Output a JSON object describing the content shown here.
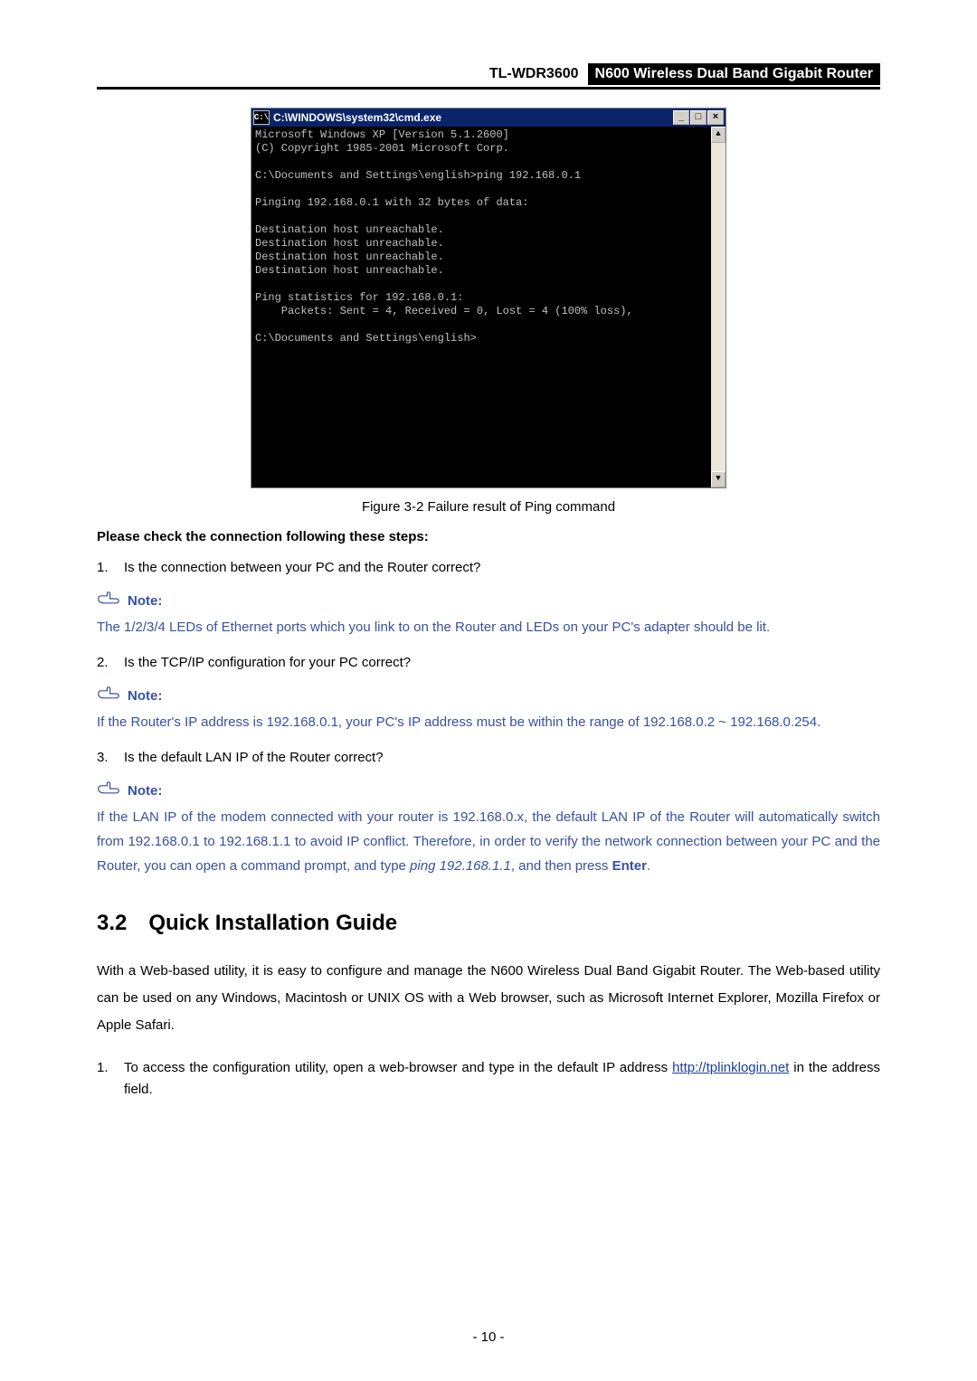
{
  "header": {
    "model": "TL-WDR3600",
    "desc": "N600 Wireless Dual Band Gigabit Router"
  },
  "cmd": {
    "icon_text": "C:\\",
    "title": "C:\\WINDOWS\\system32\\cmd.exe",
    "btn_min": "_",
    "btn_max": "□",
    "btn_close": "×",
    "scroll_up": "▲",
    "scroll_down": "▼",
    "body": "Microsoft Windows XP [Version 5.1.2600]\n(C) Copyright 1985-2001 Microsoft Corp.\n\nC:\\Documents and Settings\\english>ping 192.168.0.1\n\nPinging 192.168.0.1 with 32 bytes of data:\n\nDestination host unreachable.\nDestination host unreachable.\nDestination host unreachable.\nDestination host unreachable.\n\nPing statistics for 192.168.0.1:\n    Packets: Sent = 4, Received = 0, Lost = 4 (100% loss),\n\nC:\\Documents and Settings\\english>"
  },
  "figure_caption": "Figure 3-2 Failure result of Ping command",
  "check_heading": "Please check the connection following these steps:",
  "steps": {
    "s1_num": "1.",
    "s1_text": "Is the connection between your PC and the Router correct?",
    "s2_num": "2.",
    "s2_text": "Is the TCP/IP configuration for your PC correct?",
    "s3_num": "3.",
    "s3_text": "Is the default LAN IP of the Router correct?"
  },
  "notes": {
    "label": "Note:",
    "n1": "The 1/2/3/4 LEDs of Ethernet ports which you link to on the Router and LEDs on your PC's adapter should be lit.",
    "n2": "If the Router's IP address is 192.168.0.1, your PC's IP address must be within the range of 192.168.0.2 ~ 192.168.0.254.",
    "n3_a": "If the LAN IP of the modem connected with your router is 192.168.0.x, the default LAN IP of the Router will automatically switch from 192.168.0.1 to 192.168.1.1 to avoid IP conflict. Therefore, in order to verify the network connection between your PC and the Router, you can open a command prompt, and type ",
    "n3_cmd": "ping 192.168.1.1",
    "n3_b": ", and then press ",
    "n3_enter": "Enter",
    "n3_c": "."
  },
  "section": {
    "num": "3.2",
    "title": "Quick Installation Guide"
  },
  "para1": "With a Web-based utility, it is easy to configure and manage the N600 Wireless Dual Band Gigabit Router. The Web-based utility can be used on any Windows, Macintosh or UNIX OS with a Web browser, such as Microsoft Internet Explorer, Mozilla Firefox or Apple Safari.",
  "access_step": {
    "num": "1.",
    "a": "To access the configuration utility, open a web-browser and type in the default IP address ",
    "link": "http://tplinklogin.net",
    "b": " in the address field."
  },
  "page_number": "- 10 -"
}
